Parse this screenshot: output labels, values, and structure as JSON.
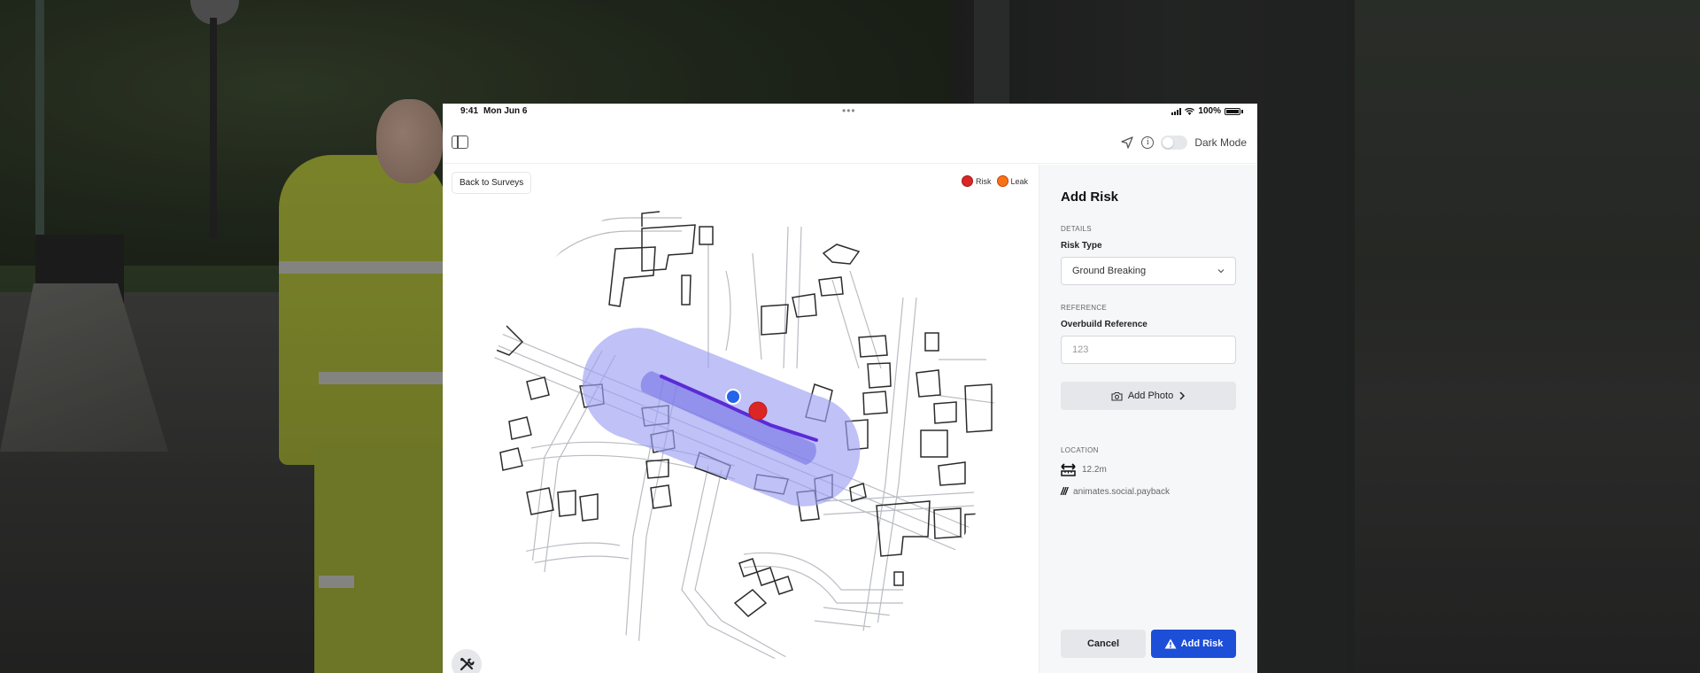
{
  "status_bar": {
    "time": "9:41",
    "date": "Mon Jun 6",
    "battery": "100%"
  },
  "toolbar": {
    "dark_mode_label": "Dark Mode",
    "dark_mode_on": false
  },
  "map": {
    "back_label": "Back to Surveys",
    "legend": [
      {
        "label": "Risk",
        "color": "#dc2626"
      },
      {
        "label": "Leak",
        "color": "#f97316"
      }
    ],
    "buffer_color": "#a5a8f5",
    "route_color": "#5b2bd6",
    "location_dot_color": "#2563eb",
    "tool_icon": "tools-icon"
  },
  "panel": {
    "title": "Add Risk",
    "details_label": "DETAILS",
    "risk_type_label": "Risk Type",
    "risk_type_value": "Ground Breaking",
    "reference_label": "REFERENCE",
    "overbuild_label": "Overbuild Reference",
    "overbuild_placeholder": "123",
    "photo_label": "Add Photo",
    "location_label": "LOCATION",
    "distance": "12.2m",
    "what3words": "animates.social.payback",
    "cancel_label": "Cancel",
    "add_label": "Add Risk"
  }
}
